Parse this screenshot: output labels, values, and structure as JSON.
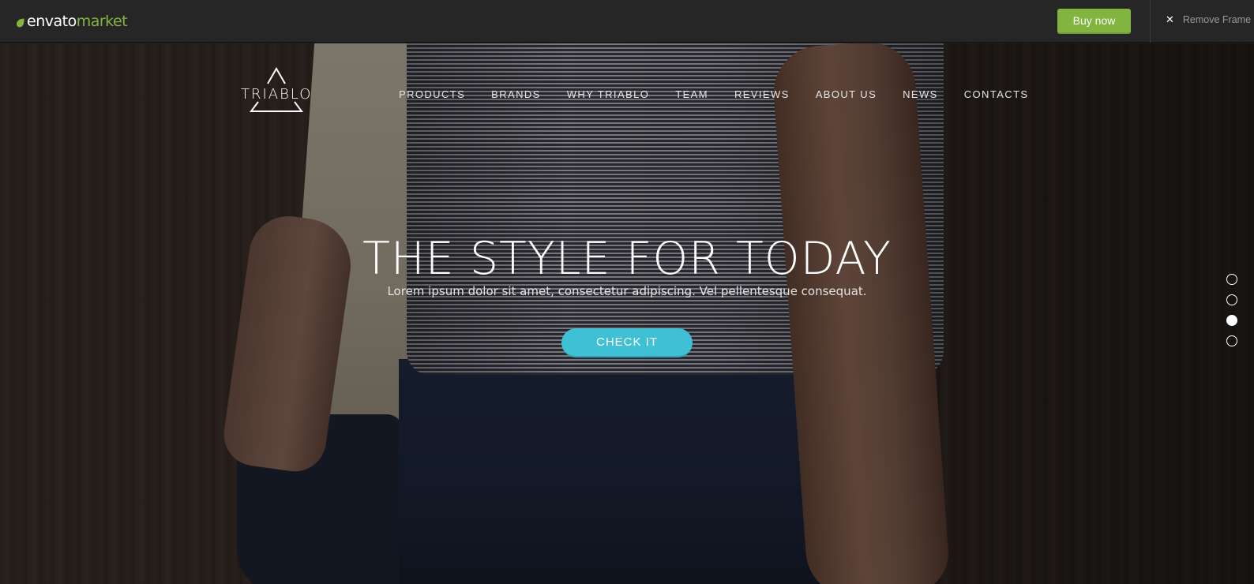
{
  "envato_bar": {
    "logo_word": "envato",
    "logo_market": "market",
    "buy_label": "Buy now",
    "remove_label": "Remove Frame",
    "accent": "#82b440"
  },
  "site": {
    "logo_text": "TRIABLO",
    "nav": [
      {
        "label": "PRODUCTS"
      },
      {
        "label": "BRANDS"
      },
      {
        "label": "WHY TRIABLO"
      },
      {
        "label": "TEAM"
      },
      {
        "label": "REVIEWS"
      },
      {
        "label": "ABOUT US"
      },
      {
        "label": "NEWS"
      },
      {
        "label": "CONTACTS"
      }
    ]
  },
  "hero": {
    "title": "THE STYLE FOR TODAY",
    "subtitle": "Lorem ipsum dolor sit amet, consectetur adipiscing. Vel pellentesque consequat.",
    "cta_label": "CHECK IT",
    "cta_color": "#3fc0d5"
  },
  "slider": {
    "count": 4,
    "active_index": 2
  }
}
